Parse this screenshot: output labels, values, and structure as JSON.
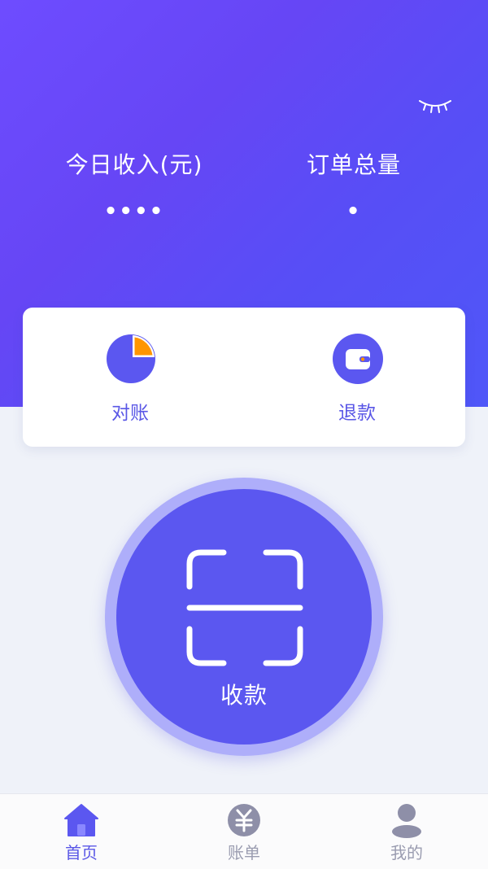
{
  "colors": {
    "primary": "#5b57f0",
    "hero_gradient_start": "#6e4cff",
    "hero_gradient_end": "#4f57f8",
    "accent_orange": "#ff9500",
    "inactive_gray": "#9a9cb0",
    "background": "#eff2f9"
  },
  "header": {
    "visibility_toggle_icon": "closed-eye-icon",
    "stats": {
      "today_income": {
        "label": "今日收入(元)",
        "value": "••••"
      },
      "order_total": {
        "label": "订单总量",
        "value": "•"
      }
    }
  },
  "actions": [
    {
      "label": "对账",
      "icon": "pie-chart-icon"
    },
    {
      "label": "退款",
      "icon": "wallet-icon"
    }
  ],
  "collect": {
    "label": "收款",
    "icon": "scan-icon"
  },
  "tabbar": {
    "active_index": 0,
    "items": [
      {
        "label": "首页",
        "icon": "home-icon"
      },
      {
        "label": "账单",
        "icon": "yuan-icon"
      },
      {
        "label": "我的",
        "icon": "user-icon"
      }
    ]
  }
}
